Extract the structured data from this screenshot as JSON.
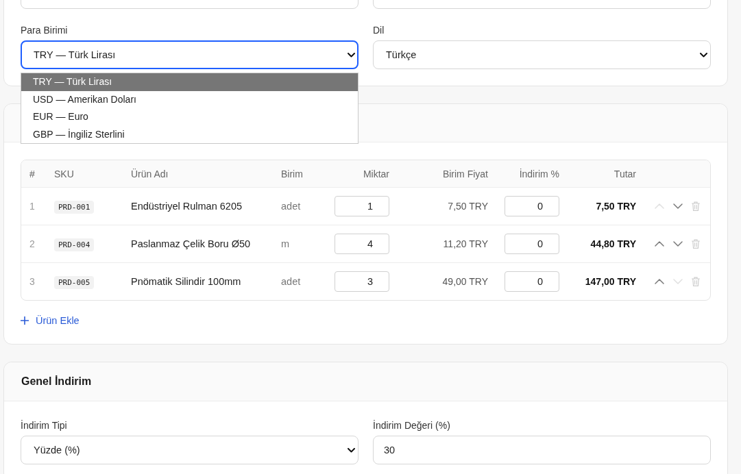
{
  "top_fields": [
    {
      "kind": "input"
    },
    {
      "kind": "input"
    }
  ],
  "settings": {
    "currency": {
      "kind": "select",
      "label": "Para Birimi",
      "value": "TRY — Türk Lirası",
      "focused": true,
      "expanded": true,
      "options": [
        {
          "label": "TRY — Türk Lirası",
          "selected": true
        },
        {
          "label": "USD — Amerikan Doları",
          "selected": false
        },
        {
          "label": "EUR — Euro",
          "selected": false
        },
        {
          "label": "GBP — İngiliz Sterlini",
          "selected": false
        }
      ]
    },
    "language": {
      "kind": "select",
      "label": "Dil",
      "value": "Türkçe",
      "focused": false
    }
  },
  "items": {
    "columns": [
      "#",
      "SKU",
      "Ürün Adı",
      "Birim",
      "Miktar",
      "Birim Fiyat",
      "İndirim %",
      "Tutar"
    ],
    "rows": [
      {
        "number": "1",
        "sku": "PRD-001",
        "name": "Endüstriyel Rulman 6205",
        "unit": "adet",
        "quantity": "1",
        "unit_price": "7,50 TRY",
        "discount": "0",
        "total": "7,50 TRY",
        "move_up_disabled": true,
        "move_down_disabled": false
      },
      {
        "number": "2",
        "sku": "PRD-004",
        "name": "Paslanmaz Çelik Boru Ø50",
        "unit": "m",
        "quantity": "4",
        "unit_price": "11,20 TRY",
        "discount": "0",
        "total": "44,80 TRY",
        "move_up_disabled": false,
        "move_down_disabled": false
      },
      {
        "number": "3",
        "sku": "PRD-005",
        "name": "Pnömatik Silindir 100mm",
        "unit": "adet",
        "quantity": "3",
        "unit_price": "49,00 TRY",
        "discount": "0",
        "total": "147,00 TRY",
        "move_up_disabled": false,
        "move_down_disabled": true
      }
    ],
    "add_button": "Ürün Ekle"
  },
  "general_discount": {
    "title": "Genel İndirim",
    "type": {
      "kind": "select",
      "label": "İndirim Tipi",
      "value": "Yüzde (%)",
      "focused": false
    },
    "amount": {
      "kind": "input",
      "label": "İndirim Değeri (%)",
      "value": "30"
    }
  }
}
